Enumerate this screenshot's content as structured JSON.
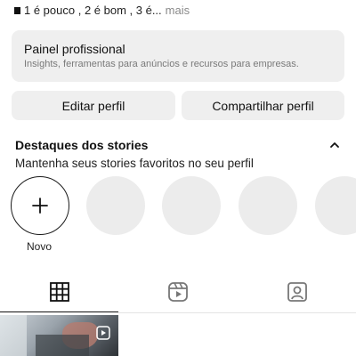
{
  "bio": {
    "text": "1 é pouco , 2 é bom , 3 é...",
    "more": "mais"
  },
  "professional_panel": {
    "title": "Painel profissional",
    "subtitle": "Insights, ferramentas para anúncios e recursos para empresas."
  },
  "actions": {
    "edit_profile": "Editar perfil",
    "share_profile": "Compartilhar perfil"
  },
  "highlights": {
    "title": "Destaques dos stories",
    "subtitle": "Mantenha seus stories favoritos no seu perfil",
    "new_label": "Novo"
  },
  "tabs": [
    {
      "icon": "grid-icon",
      "active": true
    },
    {
      "icon": "reels-icon",
      "active": false
    },
    {
      "icon": "tagged-icon",
      "active": false
    }
  ]
}
